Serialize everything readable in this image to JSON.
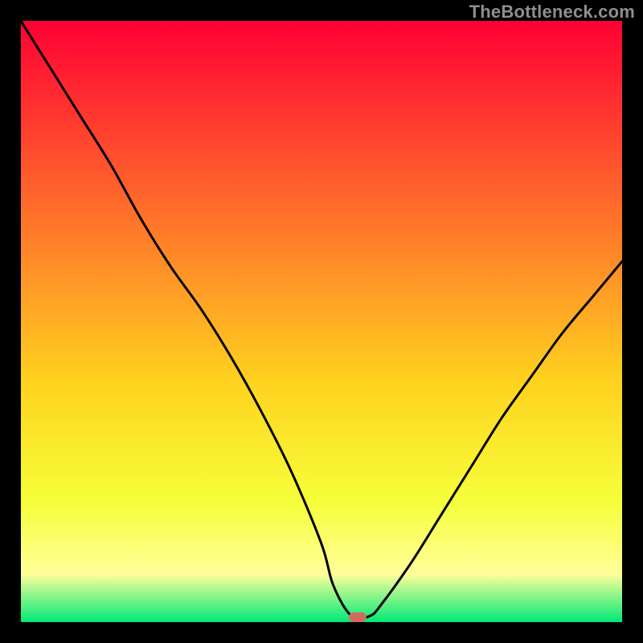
{
  "watermark": "TheBottleneck.com",
  "chart_data": {
    "type": "line",
    "title": "",
    "xlabel": "",
    "ylabel": "",
    "xlim": [
      0,
      100
    ],
    "ylim": [
      0,
      100
    ],
    "x": [
      0,
      5,
      10,
      15,
      20,
      25,
      30,
      35,
      40,
      45,
      50,
      52,
      55,
      58,
      60,
      65,
      70,
      75,
      80,
      85,
      90,
      95,
      100
    ],
    "values": [
      100,
      92,
      84,
      76,
      67,
      59,
      52,
      44,
      35,
      25,
      13,
      6,
      1,
      1,
      3,
      10,
      18,
      26,
      34,
      41,
      48,
      54,
      60
    ],
    "marker": {
      "x": 56,
      "y": 0.8,
      "color": "#d36a5f"
    },
    "gradient_top": "#ff0033",
    "gradient_mid1": "#ff7a2a",
    "gradient_mid2": "#ffd21f",
    "gradient_mid3": "#f6ff3a",
    "gradient_mid4": "#ffff9a",
    "gradient_bot": "#00e977"
  }
}
